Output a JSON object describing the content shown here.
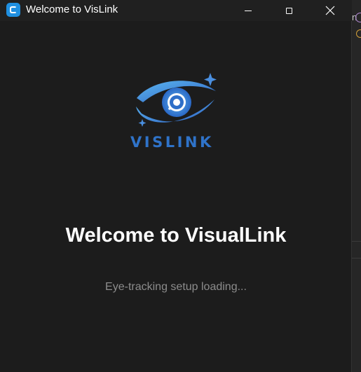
{
  "window": {
    "title": "Welcome to VisLink",
    "controls": {
      "minimize_icon": "minimize-icon",
      "maximize_icon": "maximize-icon",
      "close_icon": "close-icon"
    }
  },
  "background_window": {
    "text_fragment": "n"
  },
  "logo": {
    "wordmark": "VISLINK",
    "icon": "eye-logo"
  },
  "main": {
    "heading": "Welcome to VisualLink",
    "status": "Eye-tracking setup loading..."
  },
  "colors": {
    "accent": "#2f73c9",
    "accent_light": "#4aa3e8",
    "window_bg": "#1c1c1c",
    "titlebar_bg": "#202020"
  }
}
